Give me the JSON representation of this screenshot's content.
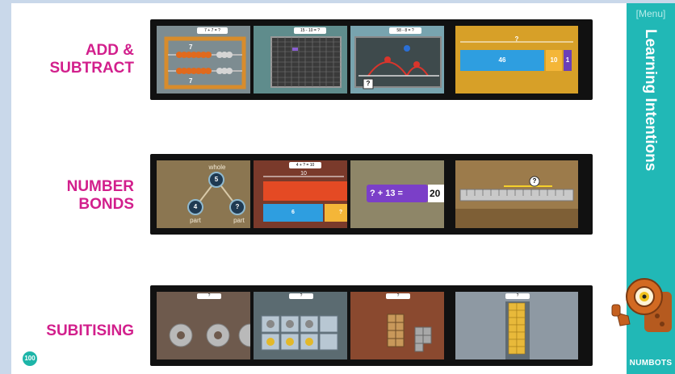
{
  "menu_link": "[Menu]",
  "sidebar_title": "Learning Intentions",
  "brand": "NUMBOTS",
  "page_number": "100",
  "rows": [
    {
      "label": "ADD &\nSUBTRACT"
    },
    {
      "label": "NUMBER\nBONDS"
    },
    {
      "label": "SUBITISING"
    }
  ],
  "thumbs": {
    "abacus_header": "7 + 7 = ?",
    "abacus_top": "7",
    "abacus_bottom": "7",
    "grid_header": "15 - 10 = ?",
    "numberline_header": "58 - 8 = ?",
    "numberline_box": "?",
    "bar_header": "?",
    "bar_a": "46",
    "bar_b": "10",
    "bar_c": "1",
    "bonds_whole": "whole",
    "bonds_top": "5",
    "bonds_left": "4",
    "bonds_right": "?",
    "bonds_part_left": "part",
    "bonds_part_right": "part",
    "bars10_header": "4 + ? = 10",
    "bars10_total": "10",
    "bars10_a": "6",
    "bars10_b": "?",
    "eq_text": "? + 13 =",
    "eq_answer": "20",
    "ruler_box": "?",
    "sub_header": "?"
  },
  "colors": {
    "label": "#d21f8c",
    "sidebar": "#21b8b6",
    "badge": "#1db5a8"
  }
}
